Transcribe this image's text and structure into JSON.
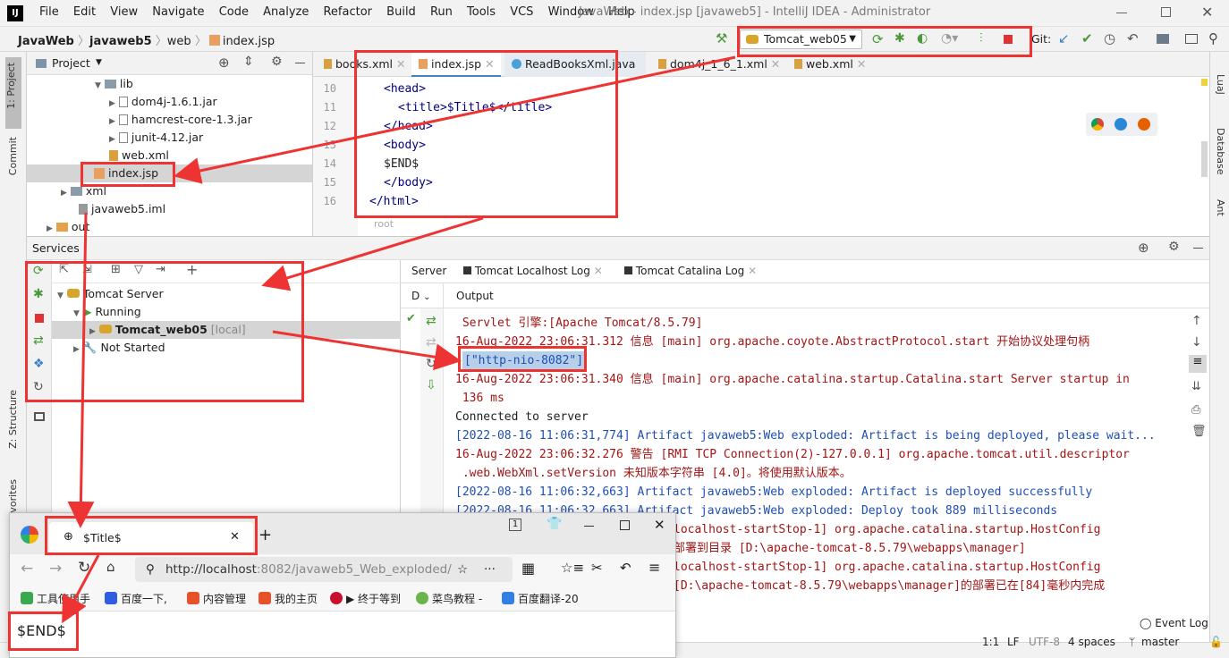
{
  "window": {
    "title": "JavaWeb - index.jsp [javaweb5] - IntelliJ IDEA - Administrator",
    "menu": [
      "File",
      "Edit",
      "View",
      "Navigate",
      "Code",
      "Analyze",
      "Refactor",
      "Build",
      "Run",
      "Tools",
      "VCS",
      "Window",
      "Help"
    ]
  },
  "breadcrumb": [
    "JavaWeb",
    "javaweb5",
    "web",
    "index.jsp"
  ],
  "toolbar": {
    "run_config": "Tomcat_web05",
    "git_label": "Git:"
  },
  "left_strip": {
    "project": "1: Project",
    "commit": "Commit",
    "structure": "Z: Structure",
    "favorites": "avorites"
  },
  "right_strip": {
    "lual": "LuaJ",
    "database": "Database",
    "ant": "Ant"
  },
  "project_panel": {
    "title": "Project",
    "items": [
      "lib",
      "dom4j-1.6.1.jar",
      "hamcrest-core-1.3.jar",
      "junit-4.12.jar",
      "web.xml",
      "index.jsp",
      "xml",
      "javaweb5.iml",
      "out"
    ]
  },
  "editor": {
    "tabs": [
      "books.xml",
      "index.jsp",
      "ReadBooksXml.java",
      "dom4j_1_6_1.xml",
      "web.xml"
    ],
    "line_numbers": [
      "10",
      "11",
      "12",
      "13",
      "14",
      "15",
      "16"
    ],
    "lines": [
      "<head>",
      "<title>$Title$</title>",
      "</head>",
      "<body>",
      "$END$",
      "</body>",
      "</html>"
    ],
    "footer": "root"
  },
  "services": {
    "title": "Services",
    "tree": [
      "Tomcat Server",
      "Running",
      "Tomcat_web05",
      "[local]",
      "Not Started"
    ],
    "tabs": [
      "Server",
      "Tomcat Localhost Log",
      "Tomcat Catalina Log"
    ],
    "col_d": "D",
    "output_label": "Output",
    "output": [
      " Servlet 引擎:[Apache Tomcat/8.5.79]",
      "16-Aug-2022 23:06:31.312 信息 [main] org.apache.coyote.AbstractProtocol.start 开始协议处理句柄",
      "[\"http-nio-8082\"]",
      "16-Aug-2022 23:06:31.340 信息 [main] org.apache.catalina.startup.Catalina.start Server startup in",
      " 136 ms",
      "Connected to server",
      "[2022-08-16 11:06:31,774] Artifact javaweb5:Web exploded: Artifact is being deployed, please wait...",
      "16-Aug-2022 23:06:32.276 警告 [RMI TCP Connection(2)-127.0.0.1] org.apache.tomcat.util.descriptor",
      " .web.WebXml.setVersion 未知版本字符串 [4.0]。将使用默认版本。",
      "[2022-08-16 11:06:32,663] Artifact javaweb5:Web exploded: Artifact is deployed successfully",
      "[2022-08-16 11:06:32,663] Artifact javaweb5:Web exploded: Deploy took 889 milliseconds",
      "localhost-startStop-1] org.apache.catalina.startup.HostConfig",
      "部署到目录 [D:\\apache-tomcat-8.5.79\\webapps\\manager]",
      "localhost-startStop-1] org.apache.catalina.startup.HostConfig",
      "[D:\\apache-tomcat-8.5.79\\webapps\\manager]的部署已在[84]毫秒内完成"
    ],
    "event_log": "Event Log"
  },
  "status": {
    "position": "1:1",
    "line_sep": "LF",
    "encoding": "UTF-8",
    "indent": "4 spaces",
    "branch": "master"
  },
  "browser": {
    "tab_title": "$Title$",
    "tab_count": "1",
    "url_host": "http://localhost",
    "url_rest": ":8082/javaweb5_Web_exploded/",
    "bookmarks": [
      "工具使用手",
      "百度一下,",
      "内容管理",
      "我的主页",
      "▶ 终于等到",
      "菜鸟教程 -",
      "百度翻译-20"
    ],
    "page_text": "$END$"
  },
  "colors": {
    "highlight_red": "#ee3333",
    "accent_blue": "#4083c9",
    "log_red": "#a31515",
    "log_blue": "#1f4fb2"
  }
}
